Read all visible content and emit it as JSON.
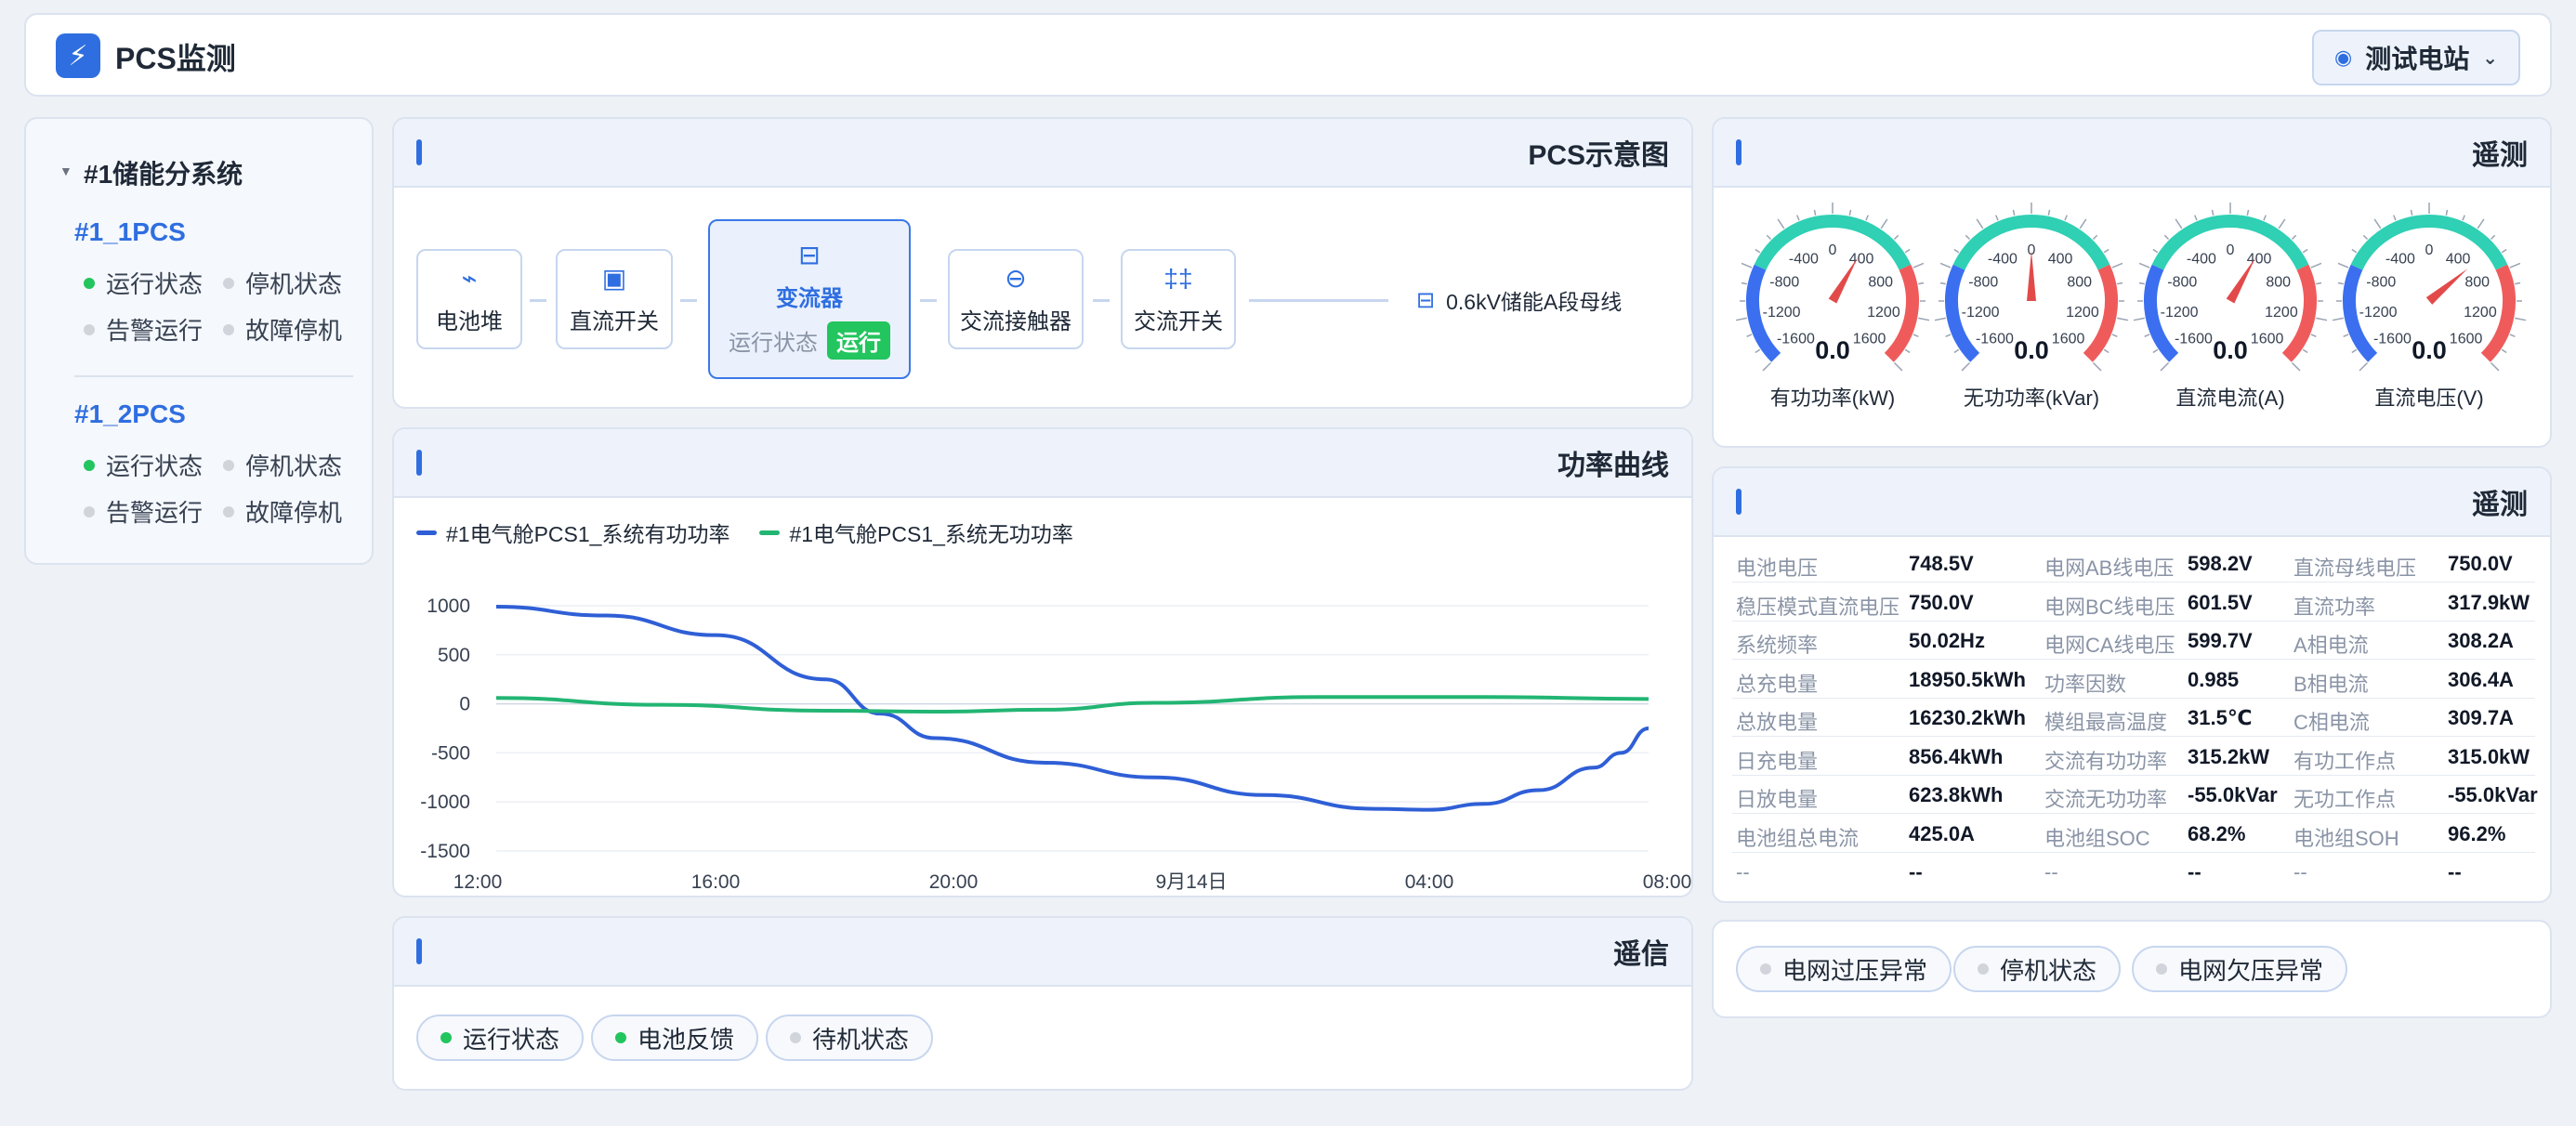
{
  "app": {
    "title": "PCS监测",
    "station": "测试电站"
  },
  "sidebar": {
    "group": "#1储能分系统",
    "pcs": [
      {
        "name": "#1_1PCS",
        "statuses": [
          {
            "label": "运行状态",
            "color": "#22c55e"
          },
          {
            "label": "停机状态",
            "color": "#d1d5db"
          },
          {
            "label": "告警运行",
            "color": "#d1d5db"
          },
          {
            "label": "故障停机",
            "color": "#d1d5db"
          }
        ]
      },
      {
        "name": "#1_2PCS",
        "statuses": [
          {
            "label": "运行状态",
            "color": "#22c55e"
          },
          {
            "label": "停机状态",
            "color": "#d1d5db"
          },
          {
            "label": "告警运行",
            "color": "#d1d5db"
          },
          {
            "label": "故障停机",
            "color": "#d1d5db"
          }
        ]
      }
    ]
  },
  "schematic": {
    "title": "PCS示意图",
    "nodes": [
      "电池堆",
      "直流开关",
      "变流器",
      "交流接触器",
      "交流开关"
    ],
    "converter_status_label": "运行状态",
    "converter_status": "运行",
    "bus": "0.6kV储能A段母线"
  },
  "chart": {
    "title": "功率曲线",
    "legend": [
      "#1电气舱PCS1_系统有功功率",
      "#1电气舱PCS1_系统无功功率"
    ]
  },
  "chart_data": {
    "type": "line",
    "x_ticks": [
      "12:00",
      "16:00",
      "20:00",
      "9月14日",
      "04:00",
      "08:00"
    ],
    "ylim": [
      -1500,
      1000
    ],
    "y_ticks": [
      1000,
      500,
      0,
      -500,
      -1000,
      -1500
    ],
    "series": [
      {
        "name": "#1电气舱PCS1_系统有功功率",
        "color": "#2f5fd6",
        "points": [
          [
            0,
            990
          ],
          [
            2,
            900
          ],
          [
            4,
            700
          ],
          [
            6,
            250
          ],
          [
            7,
            -100
          ],
          [
            8,
            -350
          ],
          [
            10,
            -600
          ],
          [
            12,
            -750
          ],
          [
            14,
            -930
          ],
          [
            16,
            -1070
          ],
          [
            17,
            -1080
          ],
          [
            18,
            -1020
          ],
          [
            19,
            -880
          ],
          [
            20,
            -650
          ],
          [
            20.5,
            -500
          ],
          [
            21,
            -250
          ]
        ]
      },
      {
        "name": "#1电气舱PCS1_系统无功功率",
        "color": "#22b573",
        "points": [
          [
            0,
            60
          ],
          [
            3,
            -10
          ],
          [
            6,
            -70
          ],
          [
            8,
            -80
          ],
          [
            10,
            -60
          ],
          [
            12,
            10
          ],
          [
            15,
            70
          ],
          [
            18,
            70
          ],
          [
            21,
            50
          ]
        ]
      }
    ]
  },
  "gauges": {
    "title": "遥测",
    "ticks": [
      "-1600",
      "-1200",
      "-800",
      "-400",
      "0",
      "400",
      "800",
      "1200",
      "1600"
    ],
    "items": [
      {
        "value": "0.0",
        "label": "有功功率(kW)"
      },
      {
        "value": "0.0",
        "label": "无功功率(kVar)"
      },
      {
        "value": "0.0",
        "label": "直流电流(A)"
      },
      {
        "value": "0.0",
        "label": "直流电压(V)"
      }
    ]
  },
  "telemetry": {
    "title": "遥测",
    "rows": [
      [
        "电池电压",
        "748.5V",
        "电网AB线电压",
        "598.2V",
        "直流母线电压",
        "750.0V"
      ],
      [
        "稳压模式直流电压",
        "750.0V",
        "电网BC线电压",
        "601.5V",
        "直流功率",
        "317.9kW"
      ],
      [
        "系统频率",
        "50.02Hz",
        "电网CA线电压",
        "599.7V",
        "A相电流",
        "308.2A"
      ],
      [
        "总充电量",
        "18950.5kWh",
        "功率因数",
        "0.985",
        "B相电流",
        "306.4A"
      ],
      [
        "总放电量",
        "16230.2kWh",
        "模组最高温度",
        "31.5℃",
        "C相电流",
        "309.7A"
      ],
      [
        "日充电量",
        "856.4kWh",
        "交流有功功率",
        "315.2kW",
        "有功工作点",
        "315.0kW"
      ],
      [
        "日放电量",
        "623.8kWh",
        "交流无功功率",
        "-55.0kVar",
        "无功工作点",
        "-55.0kVar"
      ],
      [
        "电池组总电流",
        "425.0A",
        "电池组SOC",
        "68.2%",
        "电池组SOH",
        "96.2%"
      ],
      [
        "--",
        "--",
        "--",
        "--",
        "--",
        "--"
      ]
    ]
  },
  "comm": {
    "title": "遥信",
    "items": [
      {
        "label": "运行状态",
        "color": "#22c55e"
      },
      {
        "label": "电池反馈",
        "color": "#22c55e"
      },
      {
        "label": "待机状态",
        "color": "#d1d5db"
      }
    ]
  },
  "alarms": {
    "items": [
      {
        "label": "电网过压异常",
        "color": "#d1d5db"
      },
      {
        "label": "停机状态",
        "color": "#d1d5db"
      },
      {
        "label": "电网欠压异常",
        "color": "#d1d5db"
      }
    ]
  }
}
